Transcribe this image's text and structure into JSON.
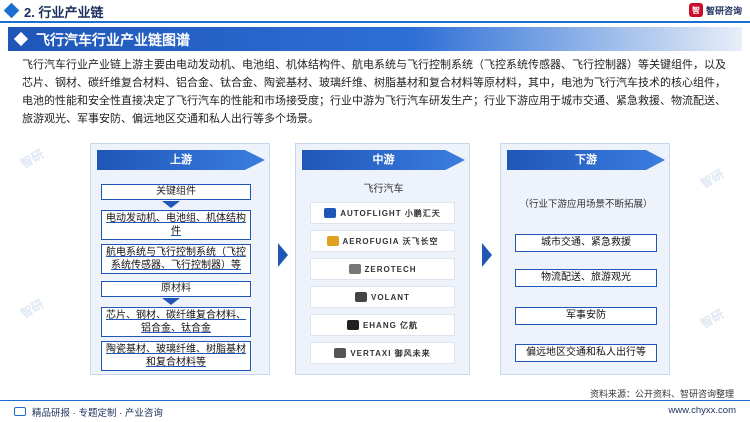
{
  "header": {
    "section_title": "2. 行业产业链",
    "brand_name": "智研咨询",
    "brand_logo_text": "智"
  },
  "banner": {
    "title": "飞行汽车行业产业链图谱"
  },
  "description": "飞行汽车行业产业链上游主要由电动发动机、电池组、机体结构件、航电系统与飞行控制系统（飞控系统传感器、飞行控制器）等关键组件，以及芯片、钢材、碳纤维复合材料、铝合金、钛合金、陶瓷基材、玻璃纤维、树脂基材和复合材料等原材料，其中，电池为飞行汽车技术的核心组件，电池的性能和安全性直接决定了飞行汽车的性能和市场接受度；行业中游为飞行汽车研发生产；行业下游应用于城市交通、紧急救援、物流配送、旅游观光、军事安防、偏远地区交通和私人出行等多个场景。",
  "upstream": {
    "heading": "上游",
    "key_components_title": "关键组件",
    "key_components": [
      "电动发动机、电池组、机体结构件",
      "航电系统与飞行控制系统（飞控系统传感器、飞行控制器）等"
    ],
    "materials_title": "原材料",
    "materials": [
      "芯片、钢材、碳纤维复合材料、铝合金、钛合金",
      "陶瓷基材、玻璃纤维、树脂基材和复合材料等"
    ]
  },
  "midstream": {
    "heading": "中游",
    "label": "飞行汽车",
    "logos": [
      {
        "text": "AUTOFLIGHT  小鹏汇天",
        "color": "#1f56b8"
      },
      {
        "text": "AEROFUGIA 沃飞长空",
        "color": "#e0a020"
      },
      {
        "text": "ZEROTECH",
        "color": "#555555"
      },
      {
        "text": "VOLANT",
        "color": "#333333"
      },
      {
        "text": "EHANG 亿航",
        "color": "#222222"
      },
      {
        "text": "VERTAXI 御风未来",
        "color": "#333333"
      }
    ]
  },
  "downstream": {
    "heading": "下游",
    "note": "（行业下游应用场景不断拓展）",
    "items": [
      "城市交通、紧急救援",
      "物流配送、旅游观光",
      "军事安防",
      "偏远地区交通和私人出行等"
    ]
  },
  "source": "资料来源：公开资料、智研咨询整理",
  "footer": {
    "left": "精品研报 · 专题定制 · 产业咨询",
    "right": "www.chyxx.com"
  }
}
